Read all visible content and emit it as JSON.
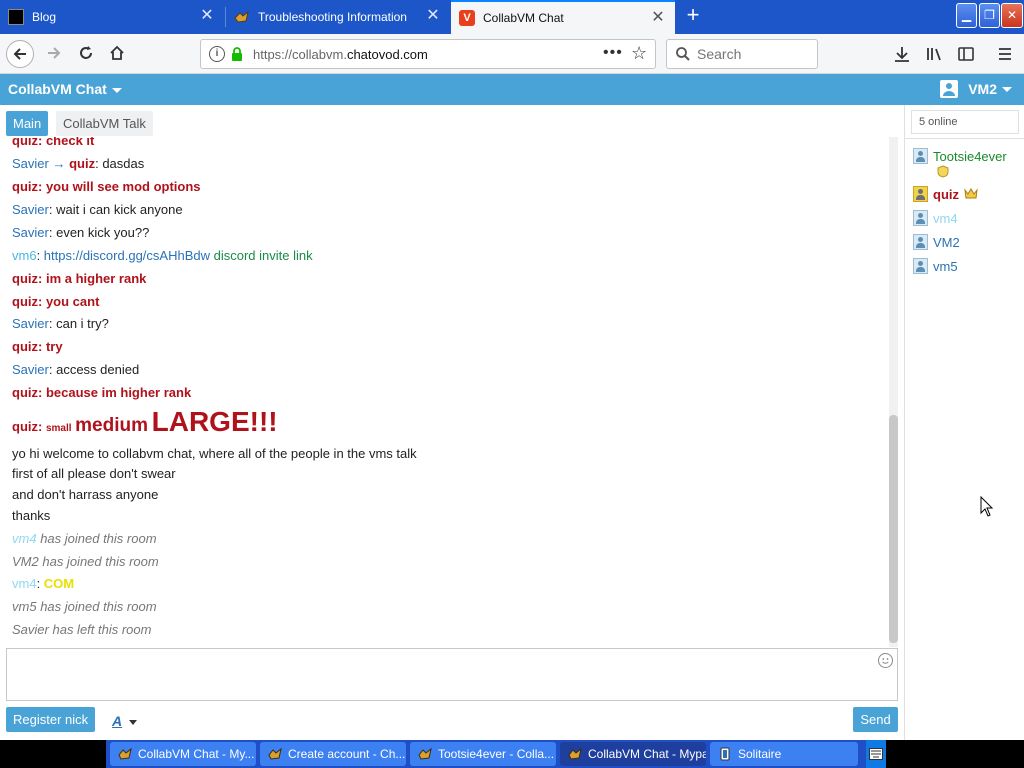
{
  "browser": {
    "tabs": [
      {
        "label": "Blog",
        "active": false
      },
      {
        "label": "Troubleshooting Information",
        "active": false
      },
      {
        "label": "CollabVM Chat",
        "active": true
      }
    ],
    "url_prefix": "https://collabvm.",
    "url_domain": "chatovod.com",
    "search_placeholder": "Search"
  },
  "app": {
    "title": "CollabVM Chat",
    "vm_selector": "VM2"
  },
  "rooms": [
    {
      "label": "Main",
      "active": true
    },
    {
      "label": "CollabVM Talk",
      "active": false
    }
  ],
  "messages": [
    {
      "user": "quiz",
      "text": "check it",
      "kind": "mod",
      "top": 0
    },
    {
      "user": "Savier",
      "to": "quiz",
      "text": "dasdas",
      "kind": "private"
    },
    {
      "user": "quiz",
      "text": "you will see mod options",
      "kind": "mod"
    },
    {
      "user": "Savier",
      "text": "wait i can kick anyone",
      "kind": "normal"
    },
    {
      "user": "Savier",
      "text": "even kick you??",
      "kind": "normal"
    },
    {
      "user": "vm6",
      "link": "https://discord.gg/csAHhBdw",
      "text": "discord invite link",
      "kind": "link"
    },
    {
      "user": "quiz",
      "text": "im a higher rank",
      "kind": "mod"
    },
    {
      "user": "quiz",
      "text": "you cant",
      "kind": "mod"
    },
    {
      "user": "Savier",
      "text": "can i try?",
      "kind": "normal"
    },
    {
      "user": "quiz",
      "text": "try",
      "kind": "mod"
    },
    {
      "user": "Savier",
      "text": "access denied",
      "kind": "normal"
    },
    {
      "user": "quiz",
      "text": "because im higher rank",
      "kind": "mod"
    },
    {
      "user": "quiz",
      "small": "small",
      "medium": "medium",
      "large": "LARGE!!!",
      "kind": "sizes"
    },
    {
      "text": "yo hi welcome to collabvm chat, where all of the people in the vms talk",
      "kind": "plain"
    },
    {
      "text": "first of all please don't swear",
      "kind": "plain"
    },
    {
      "text": "and don't harrass anyone",
      "kind": "plain"
    },
    {
      "text": "thanks",
      "kind": "plain"
    },
    {
      "user": "vm4",
      "text": "has joined this room",
      "kind": "join-vm4"
    },
    {
      "user": "VM2",
      "text": "has joined this room",
      "kind": "join"
    },
    {
      "user": "vm4",
      "text": "COM",
      "kind": "com"
    },
    {
      "user": "vm5",
      "text": "has joined this room",
      "kind": "join"
    },
    {
      "user": "Savier",
      "text": "has left this room",
      "kind": "join"
    }
  ],
  "composer": {
    "register_label": "Register nick",
    "format_label": "A",
    "send_label": "Send"
  },
  "users_panel": {
    "online_label": "5 online",
    "users": [
      {
        "name": "Tootsie4ever",
        "color": "#1a8a2a",
        "badge": "shield"
      },
      {
        "name": "quiz",
        "color": "#b0121b",
        "badge": "crown",
        "bold": true
      },
      {
        "name": "vm4",
        "color": "#8fd8f0"
      },
      {
        "name": "VM2",
        "color": "#2a72b8"
      },
      {
        "name": "vm5",
        "color": "#2a72b8"
      }
    ]
  },
  "taskbar": {
    "items": [
      {
        "label": "CollabVM Chat - My...",
        "active": false
      },
      {
        "label": "Create account - Ch...",
        "active": false
      },
      {
        "label": "Tootsie4ever - Colla...",
        "active": false
      },
      {
        "label": "CollabVM Chat - Mypal",
        "active": true
      },
      {
        "label": "Solitaire",
        "active": false
      }
    ]
  },
  "colors": {
    "accent": "#4aa3d6",
    "tabstrip": "#1c56c8",
    "mod_red": "#b0121b",
    "link_green": "#1a8a4a"
  }
}
